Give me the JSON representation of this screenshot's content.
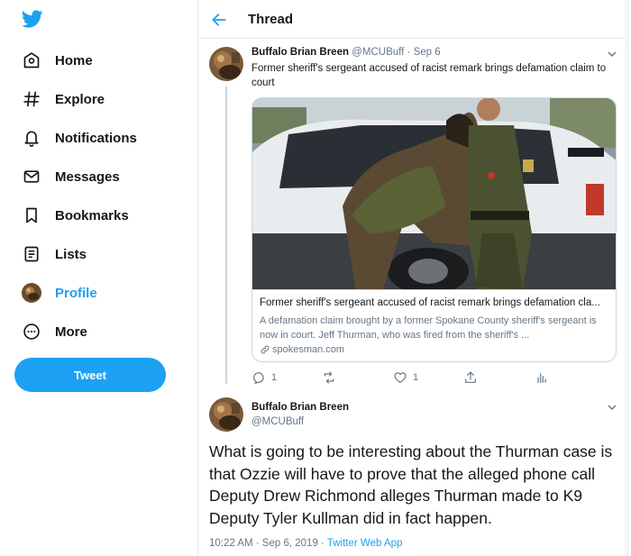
{
  "colors": {
    "accent": "#1da1f2",
    "text": "#14171a",
    "muted": "#657786",
    "border": "#e6ecf0"
  },
  "sidebar": {
    "logo_icon": "twitter-bird-icon",
    "items": [
      {
        "label": "Home",
        "icon": "home-icon"
      },
      {
        "label": "Explore",
        "icon": "hashtag-icon"
      },
      {
        "label": "Notifications",
        "icon": "bell-icon"
      },
      {
        "label": "Messages",
        "icon": "envelope-icon"
      },
      {
        "label": "Bookmarks",
        "icon": "bookmark-icon"
      },
      {
        "label": "Lists",
        "icon": "list-icon"
      },
      {
        "label": "Profile",
        "icon": "avatar",
        "active": true
      },
      {
        "label": "More",
        "icon": "more-circle-icon"
      }
    ],
    "tweet_button": "Tweet"
  },
  "header": {
    "title": "Thread"
  },
  "tweet1": {
    "name": "Buffalo Brian Breen",
    "handle": "@MCUBuff",
    "separator": "·",
    "date": "Sep 6",
    "text": "Former sheriff's sergeant accused of racist remark brings defamation claim to court",
    "card": {
      "title": "Former sheriff's sergeant accused of racist remark brings defamation cla...",
      "description": "A defamation claim brought by a former Spokane County sheriff's sergeant is now in court. Jeff Thurman, who was fired from the sheriff's ...",
      "domain": "spokesman.com"
    },
    "actions": {
      "replies": "1",
      "retweets": "",
      "likes": "1"
    }
  },
  "tweet2": {
    "name": "Buffalo Brian Breen",
    "handle": "@MCUBuff",
    "text": "What is going to be interesting about the Thurman case is that Ozzie will have to prove that the alleged phone call Deputy Drew Richmond alleges Thurman made to K9 Deputy Tyler Kullman did in fact happen.",
    "time": "10:22 AM · Sep 6, 2019 · ",
    "source": "Twitter Web App"
  }
}
